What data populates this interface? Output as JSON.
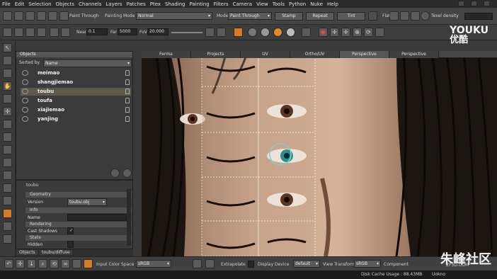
{
  "menu": [
    "File",
    "Edit",
    "Selection",
    "Objects",
    "Channels",
    "Layers",
    "Patches",
    "Ptex",
    "Shading",
    "Painting",
    "Filters",
    "Camera",
    "View",
    "Tools",
    "Python",
    "Nuke",
    "Help"
  ],
  "toolbar1": {
    "paint_through_label": "Paint Through",
    "painting_mode_label": "Painting Mode",
    "painting_mode_value": "Normal",
    "mode_label": "Mode",
    "mode_value": "Paint Through",
    "stamp": "Stamp",
    "repeat": "Repeat",
    "tint": "Tint",
    "flat_label": "Flat",
    "texel_density_label": "Texel density"
  },
  "toolbar2": {
    "near_label": "Near",
    "near_value": "0.1",
    "far_label": "Far",
    "far_value": "5000",
    "fov_label": "FoV",
    "fov_value": "20.000"
  },
  "objects_panel": {
    "title": "Objects",
    "sorted_by_label": "Sorted by",
    "sorted_by_value": "Name",
    "items": [
      "meimao",
      "shangjiemao",
      "toubu",
      "toufa",
      "xiajiemao",
      "yanjing"
    ],
    "selected": "toubu"
  },
  "properties": {
    "title": "toubu",
    "sections": [
      "Geometry",
      "Info",
      "Rendering",
      "State"
    ],
    "version_label": "Version",
    "version_value": "toubu.obj",
    "name_label": "Name",
    "cast_shadows_label": "Cast Shadows",
    "hidden_label": "Hidden"
  },
  "bottom_tabs": [
    "Objects",
    "toubu/diffuse"
  ],
  "view_tabs": [
    "Ferma",
    "Projects",
    "UV",
    "Ortho/UV",
    "Perspective",
    "Perspective"
  ],
  "active_view_tab": "Perspective",
  "status": {
    "input_color_space_label": "Input Color Space",
    "input_color_space_value": "sRGB",
    "extrapolate_label": "Extrapolate",
    "display_device_label": "Display Device",
    "display_device_value": "default",
    "view_transform_label": "View Transform",
    "view_transform_value": "sRGB",
    "component_label": "Component",
    "disk_cache": "Disk Cache Usage : 88.43MB",
    "cache_extra": "Uokno"
  },
  "watermarks": {
    "youku": "YOUKU",
    "youku_cn": "优酷",
    "zhufeng": "朱峰社区",
    "url": "ZF3D.COM"
  },
  "colors": {
    "skin": "#c9a48a",
    "iris_teal": "#2f8b8c",
    "hair": "#1a120c",
    "accent_orange": "#e08a2a"
  }
}
